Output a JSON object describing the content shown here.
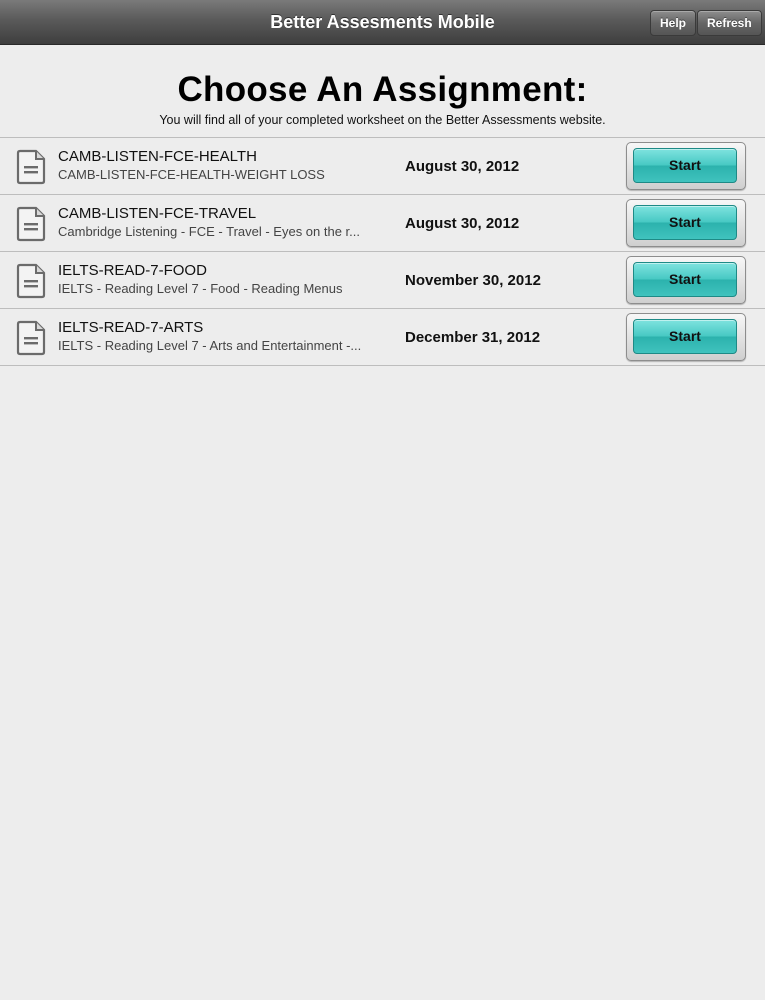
{
  "navbar": {
    "title": "Better Assesments Mobile",
    "help_label": "Help",
    "refresh_label": "Refresh"
  },
  "page": {
    "heading": "Choose An Assignment:",
    "subheading": "You will find all of your completed worksheet on the Better Assessments website."
  },
  "assignments": [
    {
      "icon": "document-icon",
      "title": "CAMB-LISTEN-FCE-HEALTH",
      "subtitle": "CAMB-LISTEN-FCE-HEALTH-WEIGHT LOSS",
      "date": "August 30, 2012",
      "button_label": "Start"
    },
    {
      "icon": "document-icon",
      "title": "CAMB-LISTEN-FCE-TRAVEL",
      "subtitle": "Cambridge Listening - FCE - Travel - Eyes on the r...",
      "date": "August 30, 2012",
      "button_label": "Start"
    },
    {
      "icon": "document-icon",
      "title": "IELTS-READ-7-FOOD",
      "subtitle": "IELTS - Reading Level 7 - Food - Reading Menus",
      "date": "November 30, 2012",
      "button_label": "Start"
    },
    {
      "icon": "document-icon",
      "title": "IELTS-READ-7-ARTS",
      "subtitle": "IELTS - Reading Level 7 - Arts and Entertainment -...",
      "date": "December 31, 2012",
      "button_label": "Start"
    }
  ],
  "colors": {
    "navbar": "#4a4a4a",
    "start_button": "#48c9c4",
    "background": "#ededed"
  }
}
